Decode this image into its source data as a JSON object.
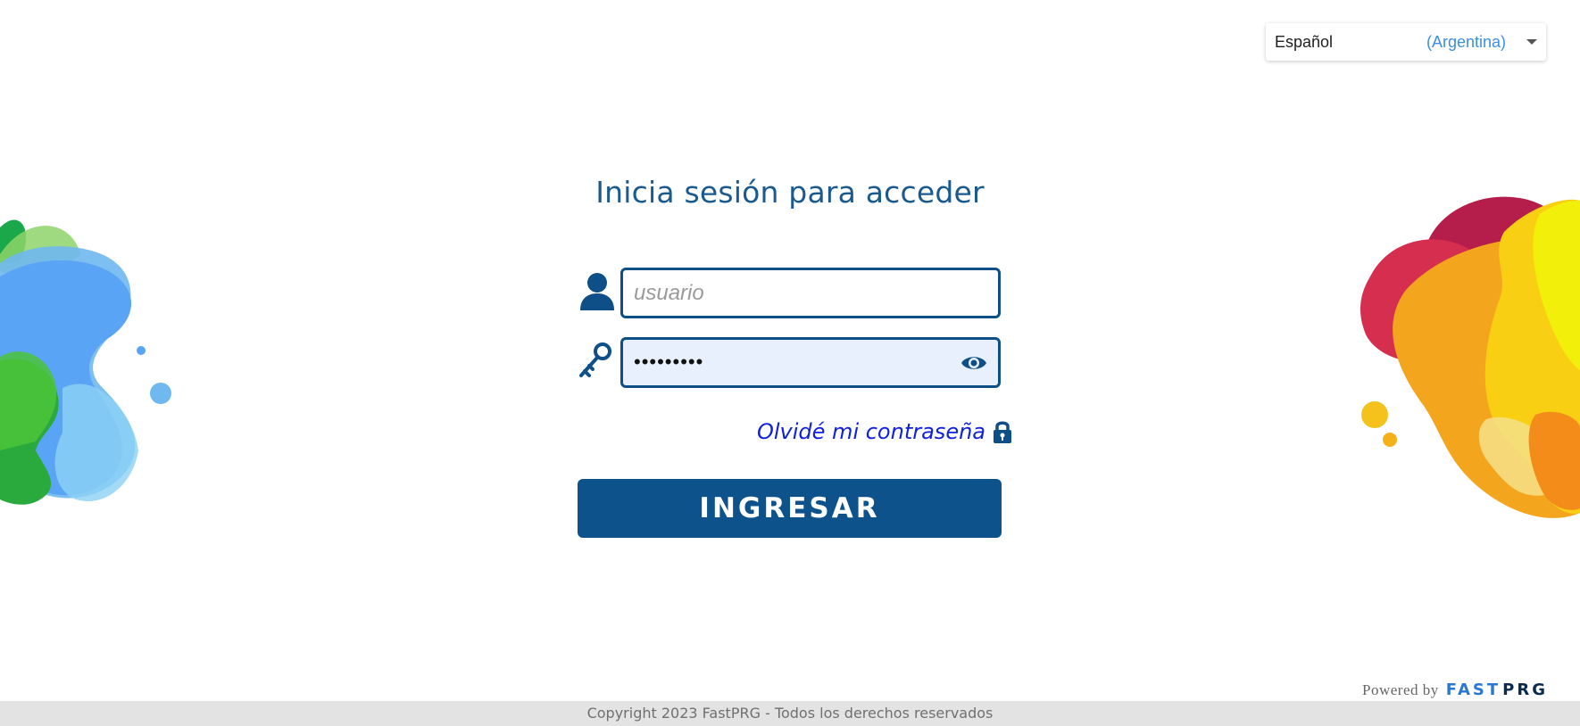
{
  "language_selector": {
    "language": "Español",
    "region": "(Argentina)"
  },
  "login": {
    "title": "Inicia sesión para acceder",
    "username_placeholder": "usuario",
    "password_masked": "•••••••••",
    "forgot_password": "Olvidé mi contraseña",
    "submit": "INGRESAR"
  },
  "powered_by": {
    "label": "Powered by",
    "brand_part1": "FAST",
    "brand_part2": "PRG"
  },
  "footer": {
    "copyright": "Copyright 2023 FastPRG - Todos los derechos reservados"
  },
  "icons": [
    "user-icon",
    "key-icon",
    "eye-icon",
    "lock-icon",
    "chevron-down-icon"
  ],
  "colors": {
    "primary": "#0d528a",
    "title": "#1a5a8e",
    "link": "#1020e0",
    "autofill_bg": "#e8f0fe",
    "footer_bg": "#e3e3e3"
  }
}
